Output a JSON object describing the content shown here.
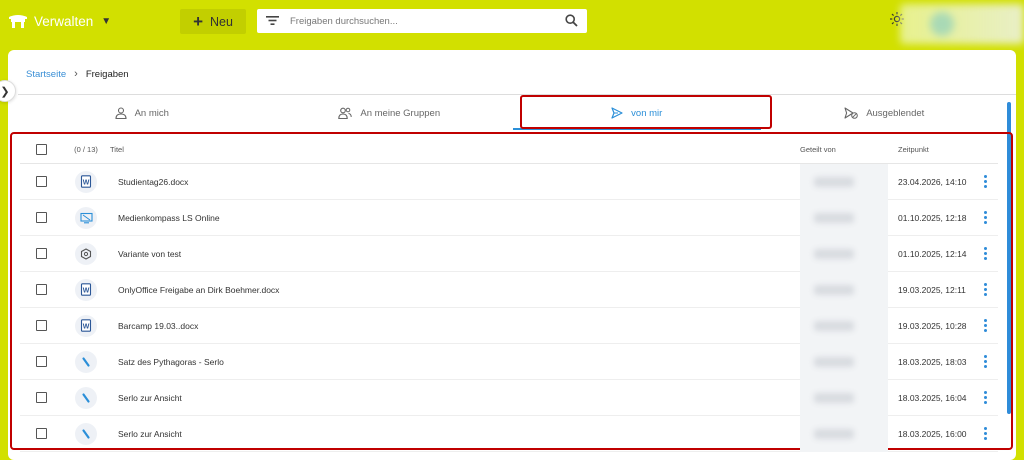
{
  "header": {
    "brand_label": "Verwalten",
    "new_button_label": "Neu",
    "search_placeholder": "Freigaben durchsuchen..."
  },
  "breadcrumb": {
    "home": "Startseite",
    "current": "Freigaben"
  },
  "tabs": [
    {
      "label": "An mich",
      "icon": "person-icon",
      "active": false
    },
    {
      "label": "An meine Gruppen",
      "icon": "group-icon",
      "active": false
    },
    {
      "label": "von mir",
      "icon": "send-icon",
      "active": true
    },
    {
      "label": "Ausgeblendet",
      "icon": "hidden-icon",
      "active": false
    }
  ],
  "table": {
    "count_label": "(0 / 13)",
    "columns": {
      "title": "Titel",
      "shared_by": "Geteilt von",
      "time": "Zeitpunkt"
    },
    "rows": [
      {
        "title": "Studientag26.docx",
        "time": "23.04.2026, 14:10",
        "icon": "word-doc-icon"
      },
      {
        "title": "Medienkompass LS Online",
        "time": "01.10.2025, 12:18",
        "icon": "screen-icon"
      },
      {
        "title": "Variante von test",
        "time": "01.10.2025, 12:14",
        "icon": "puzzle-icon"
      },
      {
        "title": "OnlyOffice Freigabe an Dirk Boehmer.docx",
        "time": "19.03.2025, 12:11",
        "icon": "word-doc-icon"
      },
      {
        "title": "Barcamp 19.03..docx",
        "time": "19.03.2025, 10:28",
        "icon": "word-doc-icon"
      },
      {
        "title": "Satz des Pythagoras - Serlo",
        "time": "18.03.2025, 18:03",
        "icon": "serlo-icon"
      },
      {
        "title": "Serlo zur Ansicht",
        "time": "18.03.2025, 16:04",
        "icon": "serlo-icon"
      },
      {
        "title": "Serlo zur Ansicht",
        "time": "18.03.2025, 16:00",
        "icon": "serlo-icon"
      }
    ]
  },
  "colors": {
    "topbar": "#d2e000",
    "accent": "#2b8fd8",
    "highlight": "#c00000"
  }
}
